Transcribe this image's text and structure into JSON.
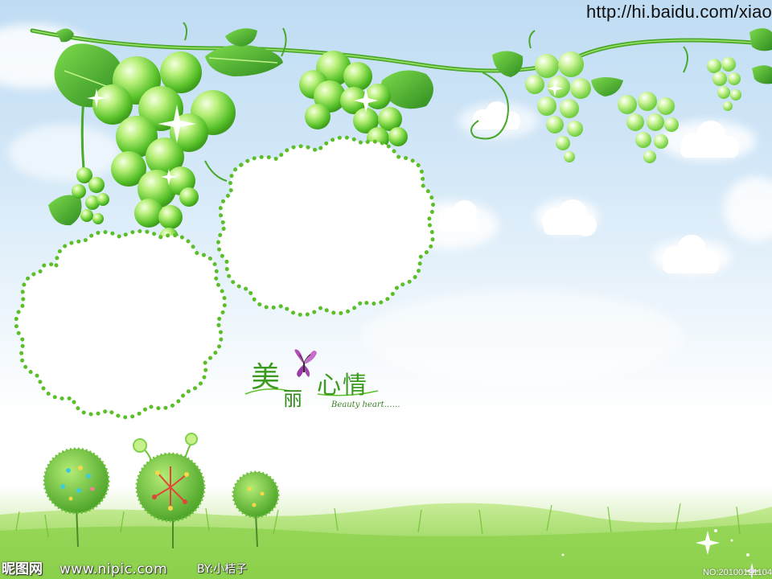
{
  "watermark": {
    "url": "http://hi.baidu.com/xiao",
    "logo": "昵图网",
    "site": "www.nipic.com",
    "author": "BY:小桔子",
    "number": "NO:20100121104"
  },
  "title": {
    "char1": "美",
    "char2": "丽",
    "char3": "心",
    "char4": "情",
    "subtitle": "Beauty heart……"
  },
  "colors": {
    "sky_top": "#bfdcf3",
    "grape_light": "#b9f07a",
    "grape_mid": "#66cc33",
    "leaf_dark": "#3a9a2a",
    "frame_dots": "#5cbf2a",
    "grass": "#9bd95a",
    "butterfly": "#b04fb8"
  },
  "icons": {
    "butterfly": "butterfly-icon",
    "sparkle": "sparkle-icon",
    "tree": "round-tree-icon"
  }
}
